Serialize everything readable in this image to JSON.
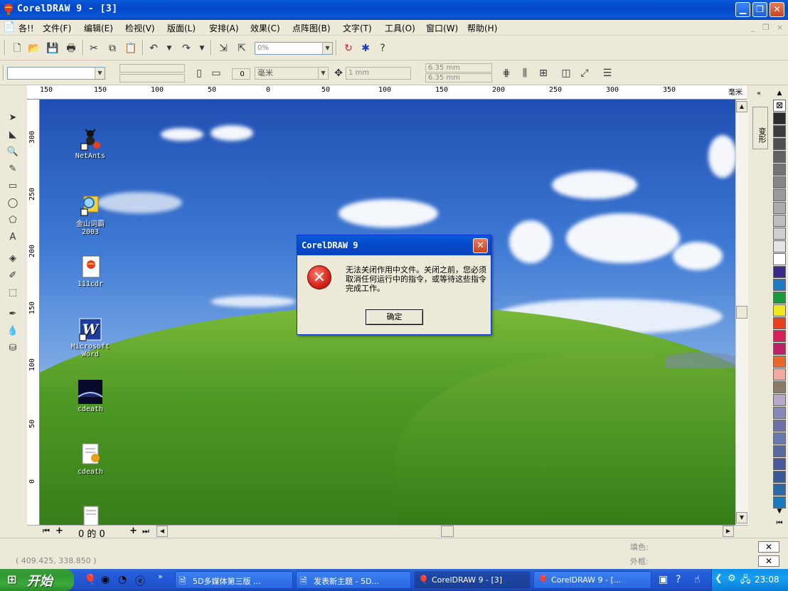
{
  "window": {
    "title": "CorelDRAW 9 - [3]",
    "min_icon": "minimize-icon",
    "restore_icon": "restore-icon",
    "close_icon": "close-icon"
  },
  "menu": {
    "items": [
      "各!!",
      "文件(F)",
      "编辑(E)",
      "检视(V)",
      "版面(L)",
      "安排(A)",
      "效果(C)",
      "点阵图(B)",
      "文字(T)",
      "工具(O)",
      "窗口(W)",
      "帮助(H)"
    ],
    "mdi_controls": [
      "_",
      "❐",
      "×"
    ]
  },
  "toolbar1": {
    "zoom_value": "0%"
  },
  "toolbar2": {
    "units_value": "毫米",
    "nudge_value": "1 mm",
    "dup_x": "6.35 mm",
    "dup_y": "6.35 mm",
    "page_count": "0"
  },
  "ruler": {
    "unit": "毫米",
    "top_labels": [
      "150",
      "100",
      "50",
      "0",
      "50",
      "100",
      "150",
      "200",
      "250",
      "300",
      "350"
    ],
    "left_labels": [
      "300",
      "250",
      "200",
      "150",
      "100",
      "50",
      "0"
    ]
  },
  "desktop_icons": [
    {
      "label": "NetAnts"
    },
    {
      "label": "金山词霸\n2003"
    },
    {
      "label": "111cdr"
    },
    {
      "label": "Microsoft\nWord"
    },
    {
      "label": "cdeath"
    },
    {
      "label": "cdeath"
    }
  ],
  "dialog": {
    "title": "CorelDRAW 9",
    "message": "无法关闭作用中文件。关闭之前，您必须取消任何运行中的指令，或等待这些指令完成工作。",
    "ok_label": "确定"
  },
  "page_nav": {
    "text": "0 的 0"
  },
  "docker": {
    "label": "变形"
  },
  "status": {
    "coords": "( 409.425, 338.850 )",
    "fill_label": "填色:",
    "outline_label": "外框:"
  },
  "taskbar": {
    "start_label": "开始",
    "tasks": [
      "5D多媒体第三版 ...",
      "发表新主题 - 5D...",
      "CorelDRAW 9 - [3]",
      "CorelDRAW 9 - [..."
    ],
    "clock": "23:08"
  },
  "palette_colors": [
    "#ffffff",
    "#2b2b2b",
    "#3d3d3d",
    "#505050",
    "#626262",
    "#747474",
    "#878787",
    "#999999",
    "#ababab",
    "#bdbdbd",
    "#cfcfcf",
    "#e4e4e4",
    "#ffffff",
    "#3a2a8a",
    "#1f79c0",
    "#1a9a3a",
    "#f0e61e",
    "#e8401c",
    "#d8205a",
    "#c0206a",
    "#e8682a",
    "#f0a8a0",
    "#8a7a6a",
    "#b8a8c8",
    "#8888b8",
    "#7070a8",
    "#6878b0",
    "#5868a0",
    "#48589a",
    "#3a5898",
    "#2a6aa8",
    "#1a7ac0"
  ]
}
